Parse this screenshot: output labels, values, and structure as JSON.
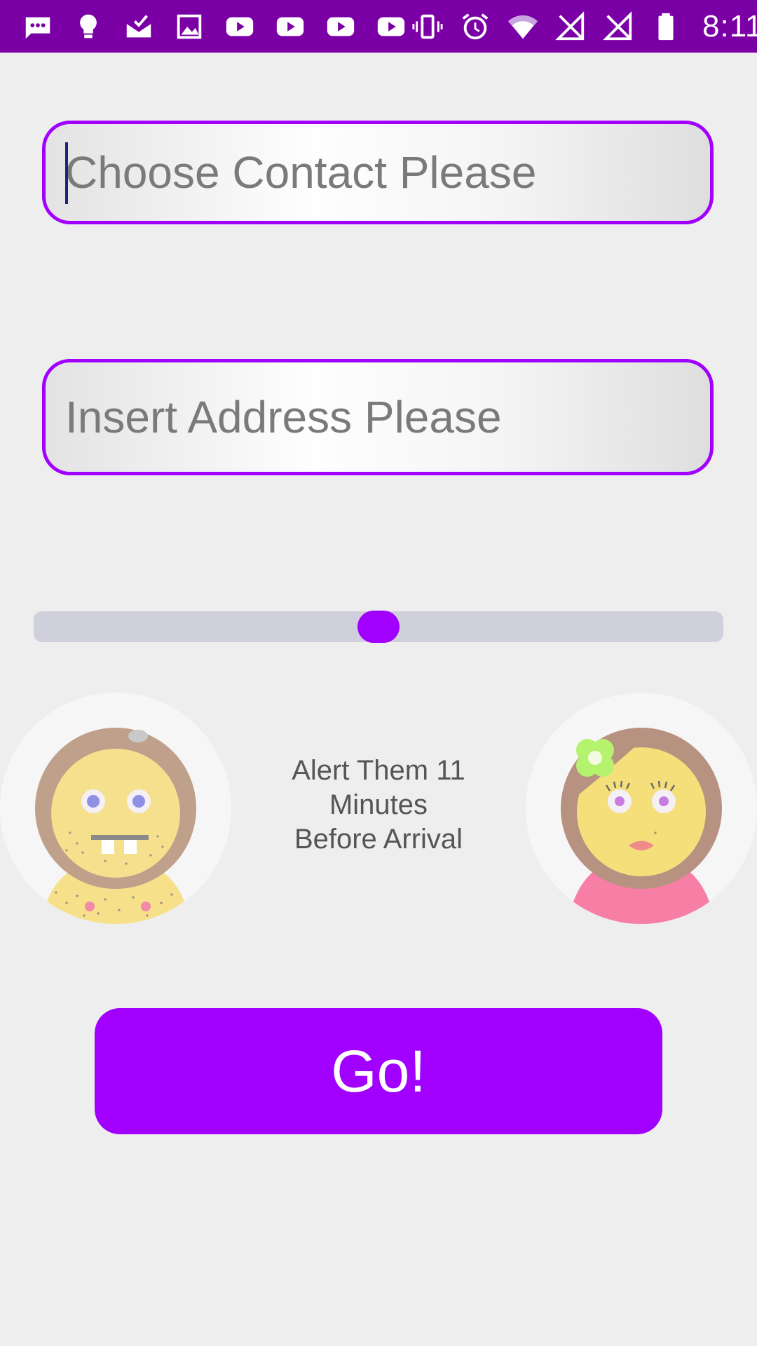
{
  "status_bar": {
    "time": "8:11",
    "left_icons": [
      "chat-bubble-icon",
      "lightbulb-icon",
      "check-mail-icon",
      "image-icon",
      "youtube-icon",
      "youtube-icon",
      "youtube-icon",
      "youtube-icon"
    ],
    "right_icons": [
      "vibrate-icon",
      "alarm-icon",
      "wifi-icon",
      "no-signal-icon",
      "no-signal-icon",
      "battery-icon"
    ],
    "background_color": "#7a00a5"
  },
  "form": {
    "contact_placeholder": "Choose Contact Please",
    "contact_value": "",
    "address_placeholder": "Insert Address Please",
    "address_value": ""
  },
  "slider": {
    "value_fraction": 0.5,
    "accent_color": "#a100ff"
  },
  "alert": {
    "line1": "Alert Them 11",
    "line2": "Minutes",
    "line3": "Before Arrival"
  },
  "go_button_label": "Go!",
  "theme": {
    "accent": "#a100ff",
    "background": "#eeeeef"
  }
}
